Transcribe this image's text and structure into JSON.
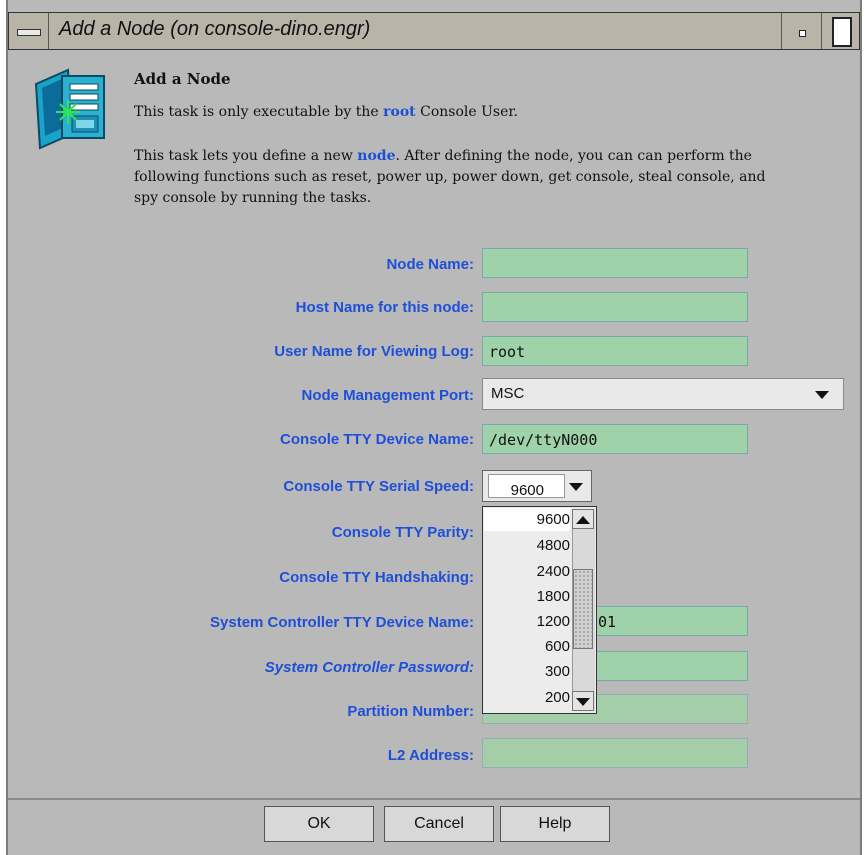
{
  "window": {
    "title": "Add a Node (on console-dino.engr)"
  },
  "header": {
    "icon": "add-node-icon",
    "heading": "Add a Node",
    "line1_prefix": "This task is only executable by the",
    "line1_link": "root",
    "line1_suffix": "Console User.",
    "line2_prefix": "This task lets you define a new",
    "line2_link": "node",
    "line2_suffix": ". After defining the node, you can can perform the",
    "line3": "following functions such as reset, power up, power down, get console, steal console, and",
    "line4": "spy console by running the tasks."
  },
  "form": {
    "node_name": {
      "label": "Node Name:",
      "value": ""
    },
    "host_name": {
      "label": "Host Name for this node:",
      "value": ""
    },
    "user_name": {
      "label": "User Name for Viewing Log:",
      "value": "root"
    },
    "mgmt_port": {
      "label": "Node Management Port:",
      "value": "MSC"
    },
    "tty_device": {
      "label": "Console TTY Device Name:",
      "value": "/dev/ttyN000"
    },
    "tty_speed": {
      "label": "Console TTY Serial Speed:",
      "value": "9600"
    },
    "tty_parity": {
      "label": "Console TTY Parity:"
    },
    "tty_handshaking": {
      "label": "Console TTY Handshaking:"
    },
    "sc_tty_device": {
      "label": "System Controller TTY Device Name:",
      "visible_value": "01"
    },
    "sc_password": {
      "label": "System Controller Password:"
    },
    "partition": {
      "label": "Partition Number:",
      "value": ""
    },
    "l2_address": {
      "label": "L2 Address:",
      "value": ""
    }
  },
  "speed_dropdown": {
    "options": [
      "9600",
      "4800",
      "2400",
      "1800",
      "1200",
      "600",
      "300",
      "200"
    ],
    "selected": "9600"
  },
  "buttons": {
    "ok": "OK",
    "cancel": "Cancel",
    "help": "Help"
  }
}
